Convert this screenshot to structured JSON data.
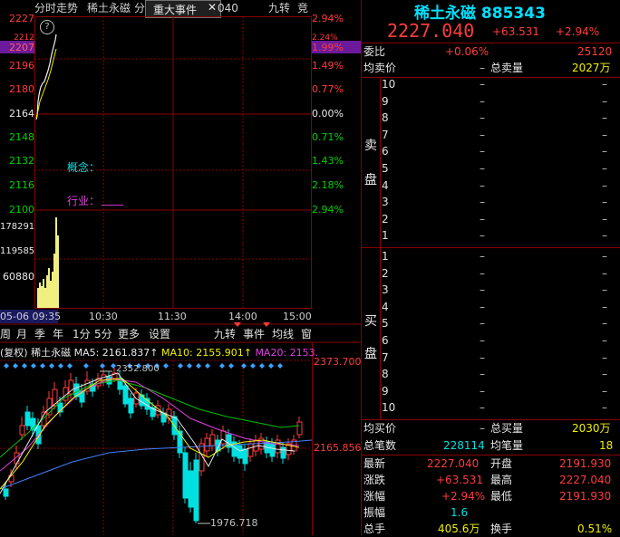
{
  "header": {
    "stock_name": "稀土永磁",
    "stock_code": "885343",
    "price": "2227.040",
    "change": "+63.531",
    "change_pct": "+2.94%"
  },
  "intraday": {
    "tabs": {
      "timeshare": "分时走势",
      "name": "稀土永磁",
      "fen": "分",
      "event": "重大事件",
      "close": "✕",
      "code_fragment": "040",
      "jiuzhuan": "九转",
      "jing": "竞"
    },
    "help": "?",
    "price_labels": [
      "2227",
      "2212",
      "2207",
      "2196",
      "2180",
      "2164",
      "2148",
      "2132",
      "2116",
      "2100",
      "178291",
      "119585",
      "60880"
    ],
    "pct_labels": [
      "2.94%",
      "2.24%",
      "1.99%",
      "1.49%",
      "0.77%",
      "0.00%",
      "0.71%",
      "1.43%",
      "2.18%",
      "2.94%"
    ],
    "concept_label": "概念：",
    "industry_label": "行业：",
    "industry_value": "____",
    "time_labels": [
      "05-06 09:35",
      "10:30",
      "11:30",
      "14:00",
      "15:00"
    ]
  },
  "kline": {
    "tabs": [
      "周",
      "月",
      "季",
      "年",
      "1分",
      "5分",
      "更多",
      "设置"
    ],
    "right_tabs": [
      "九转",
      "事件",
      "均线",
      "窗"
    ],
    "legend": {
      "prefix": "(复权)",
      "name": "稀土永磁",
      "ma5": "MA5: 2161.837↑",
      "ma10": "MA10: 2155.901↑",
      "ma20": "MA20: 2153."
    },
    "high_label": "2352.800",
    "low_label": "1976.718",
    "axis_top": "2373.700",
    "axis_mid": "2165.856",
    "colors": {
      "up": "#ff3c3c",
      "down": "#00e0e0",
      "ma5": "#e8e8e8",
      "ma10": "#f0f000",
      "ma20": "#e040e0",
      "ma60": "#00c000",
      "ma120": "#4080ff"
    }
  },
  "quote": {
    "weibi_label": "委比",
    "weibi_pct": "+0.06%",
    "weibi_val": "25120",
    "avg_sell_label": "均卖价",
    "avg_sell_val": "–",
    "total_sell_label": "总卖量",
    "total_sell_val": "2027万",
    "sell_label_1": "卖",
    "sell_label_2": "盘",
    "buy_label_1": "买",
    "buy_label_2": "盘",
    "sell_levels": [
      "10",
      "9",
      "8",
      "7",
      "6",
      "5",
      "4",
      "3",
      "2",
      "1"
    ],
    "buy_levels": [
      "1",
      "2",
      "3",
      "4",
      "5",
      "6",
      "7",
      "8",
      "9",
      "10"
    ],
    "dash": "–",
    "avg_buy_label": "均买价",
    "avg_buy_val": "–",
    "total_buy_label": "总买量",
    "total_buy_val": "2030万",
    "total_trades_label": "总笔数",
    "total_trades_val": "228114",
    "avg_trade_label": "均笔量",
    "avg_trade_val": "18",
    "latest_label": "最新",
    "latest_val": "2227.040",
    "open_label": "开盘",
    "open_val": "2191.930",
    "chg_label": "涨跌",
    "chg_val": "+63.531",
    "high_label": "最高",
    "high_val": "2227.040",
    "chgpct_label": "涨幅",
    "chgpct_val": "+2.94%",
    "low_label": "最低",
    "low_val": "2191.930",
    "amp_label": "振幅",
    "amp_val": "1.6",
    "vol_label": "总手",
    "vol_val": "405.6万",
    "turnover_label": "换手",
    "turnover_val": "0.51%"
  }
}
